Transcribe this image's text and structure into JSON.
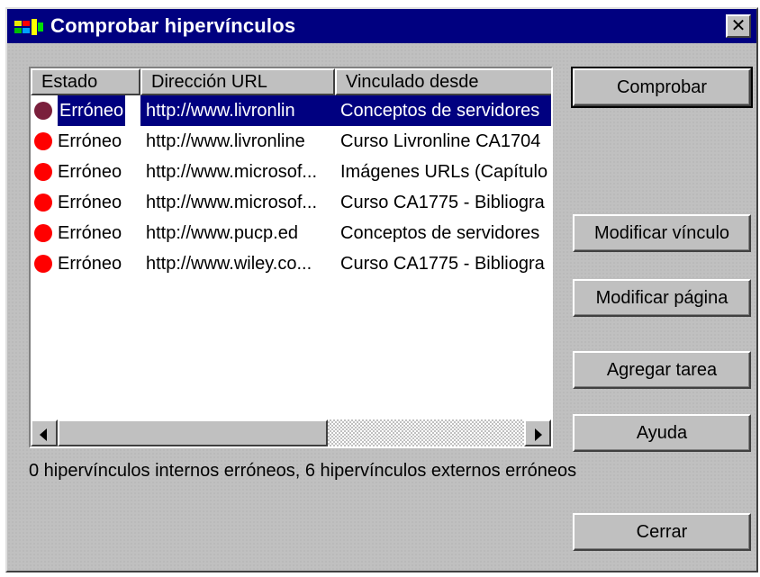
{
  "window": {
    "title": "Comprobar hipervínculos",
    "close_glyph": "✕"
  },
  "list": {
    "columns": [
      "Estado",
      "Dirección URL",
      "Vinculado desde"
    ],
    "rows": [
      {
        "state": "Erróneo",
        "url": "http://www.livronlin",
        "from": "Conceptos de servidores",
        "dot_color": "#7a1f3c",
        "selected": true
      },
      {
        "state": "Erróneo",
        "url": "http://www.livronline",
        "from": "Curso Livronline CA1704",
        "dot_color": "#ff0000",
        "selected": false
      },
      {
        "state": "Erróneo",
        "url": "http://www.microsof...",
        "from": "Imágenes URLs (Capítulo",
        "dot_color": "#ff0000",
        "selected": false
      },
      {
        "state": "Erróneo",
        "url": "http://www.microsof...",
        "from": "Curso CA1775 - Bibliogra",
        "dot_color": "#ff0000",
        "selected": false
      },
      {
        "state": "Erróneo",
        "url": "http://www.pucp.ed",
        "from": "Conceptos de servidores",
        "dot_color": "#ff0000",
        "selected": false
      },
      {
        "state": "Erróneo",
        "url": "http://www.wiley.co...",
        "from": "Curso CA1775 - Bibliogra",
        "dot_color": "#ff0000",
        "selected": false
      }
    ]
  },
  "buttons": {
    "check": "Comprobar",
    "edit_link": "Modificar vínculo",
    "edit_page": "Modificar página",
    "add_task": "Agregar tarea",
    "help": "Ayuda",
    "close": "Cerrar"
  },
  "status": "0 hipervínculos internos erróneos, 6 hipervínculos externos erróneos",
  "colors": {
    "titlebar": "#000080",
    "selection": "#000080",
    "dialog": "#c0c0c0"
  }
}
